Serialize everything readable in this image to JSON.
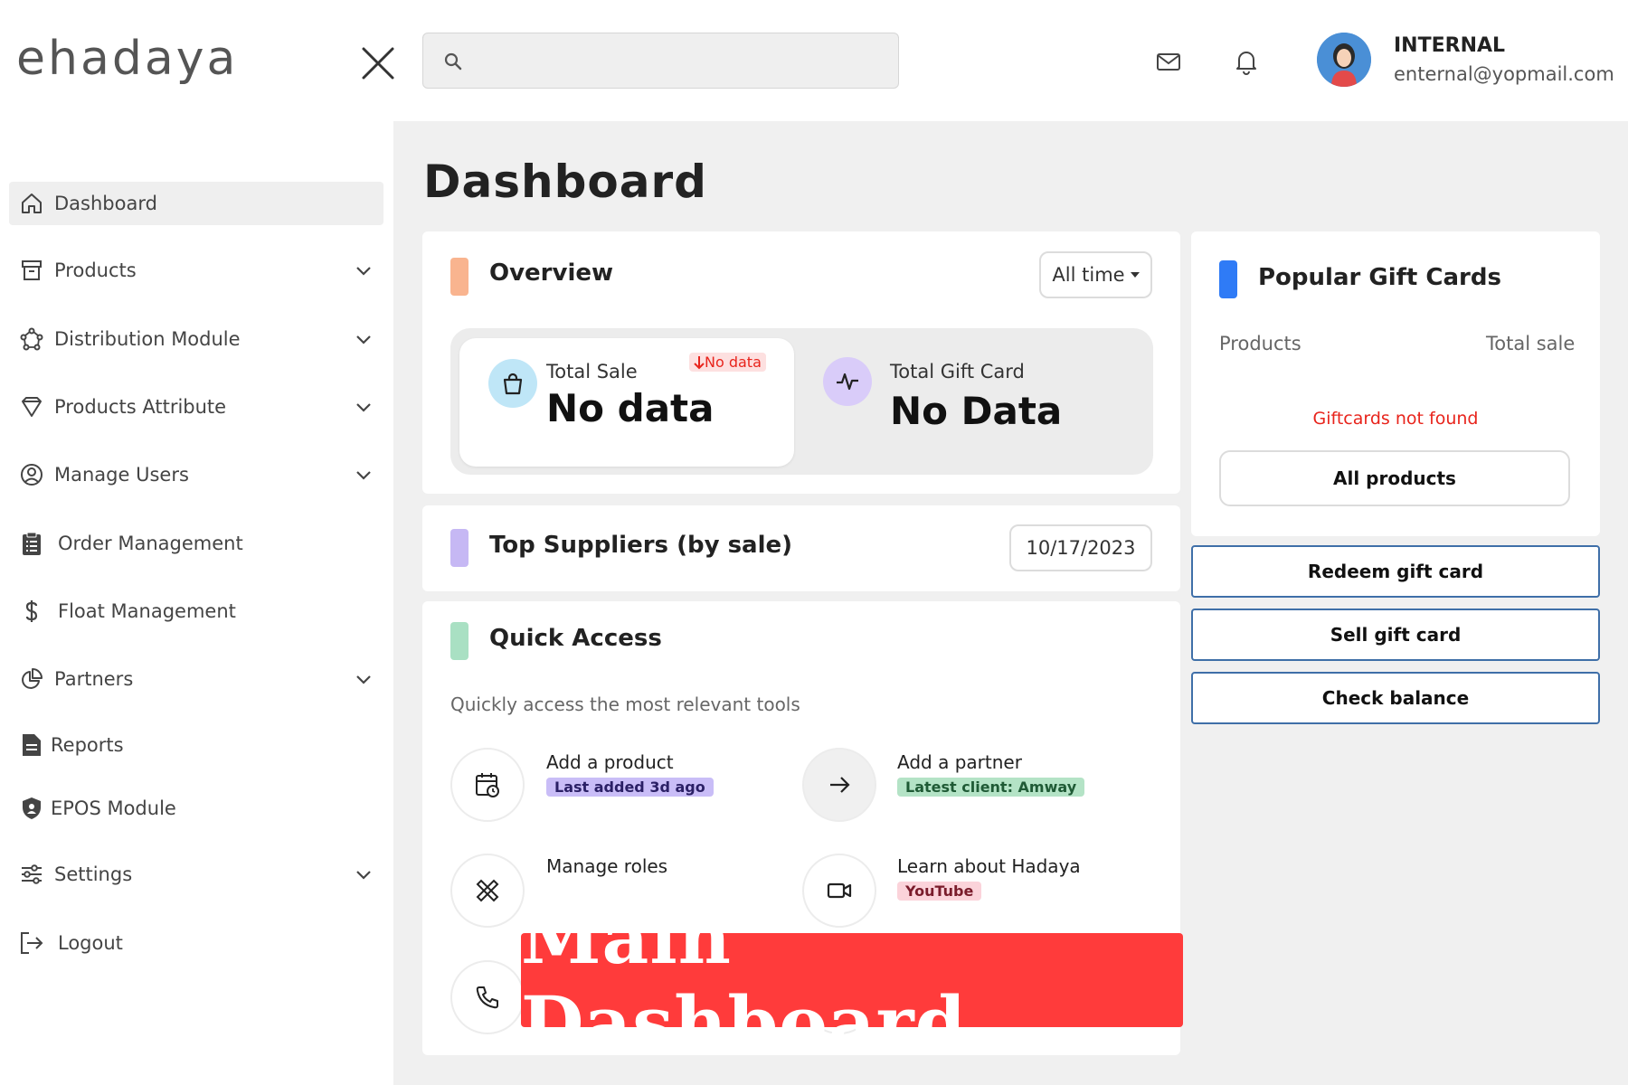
{
  "header": {
    "logo_text": "ehadaya",
    "search": {
      "value": "",
      "placeholder": ""
    },
    "user": {
      "name": "INTERNAL",
      "email": "enternal@yopmail.com"
    }
  },
  "sidebar": {
    "items": [
      {
        "label": "Dashboard",
        "icon": "home-icon",
        "active": true,
        "expandable": false
      },
      {
        "label": "Products",
        "icon": "archive-icon",
        "expandable": true
      },
      {
        "label": "Distribution Module",
        "icon": "network-icon",
        "expandable": true
      },
      {
        "label": "Products Attribute",
        "icon": "diamond-icon",
        "expandable": true
      },
      {
        "label": "Manage Users",
        "icon": "user-circle-icon",
        "expandable": true
      },
      {
        "label": "Order Management",
        "icon": "clipboard-icon",
        "expandable": false
      },
      {
        "label": "Float Management",
        "icon": "dollar-icon",
        "expandable": false
      },
      {
        "label": "Partners",
        "icon": "pie-chart-icon",
        "expandable": true
      },
      {
        "label": "Reports",
        "icon": "document-icon",
        "expandable": false
      },
      {
        "label": "EPOS Module",
        "icon": "shield-icon",
        "expandable": false
      },
      {
        "label": "Settings",
        "icon": "sliders-icon",
        "expandable": true
      },
      {
        "label": "Logout",
        "icon": "logout-icon",
        "expandable": false
      }
    ]
  },
  "main": {
    "title": "Dashboard",
    "overview": {
      "title": "Overview",
      "filter": "All time",
      "total_sale": {
        "label": "Total Sale",
        "value": "No data",
        "trend": "No data"
      },
      "total_gift_card": {
        "label": "Total Gift Card",
        "value": "No Data"
      }
    },
    "top_suppliers": {
      "title": "Top Suppliers (by sale)",
      "date": "10/17/2023"
    },
    "quick_access": {
      "title": "Quick Access",
      "subtitle": "Quickly access the most relevant tools",
      "items": [
        {
          "label": "Add a product",
          "tag": "Last added 3d ago"
        },
        {
          "label": "Add a partner",
          "tag": "Latest client: Amway"
        },
        {
          "label": "Manage roles",
          "tag": ""
        },
        {
          "label": "Learn about Hadaya",
          "tag": "YouTube"
        }
      ]
    },
    "popular_gift_cards": {
      "title": "Popular Gift Cards",
      "col_products": "Products",
      "col_total_sale": "Total sale",
      "empty_message": "Giftcards not found",
      "all_products_label": "All products"
    },
    "gift_card_actions": [
      "Redeem gift card",
      "Sell gift card",
      "Check balance"
    ]
  },
  "overlay_banner": "Main Dashboard",
  "colors": {
    "overview_accent": "#f9b48f",
    "suppliers_accent": "#c6b8f4",
    "quick_access_accent": "#a9e0c3",
    "gift_cards_accent": "#2f7bf6",
    "error_red": "#e8241c",
    "banner_red": "#ff3b3b"
  }
}
